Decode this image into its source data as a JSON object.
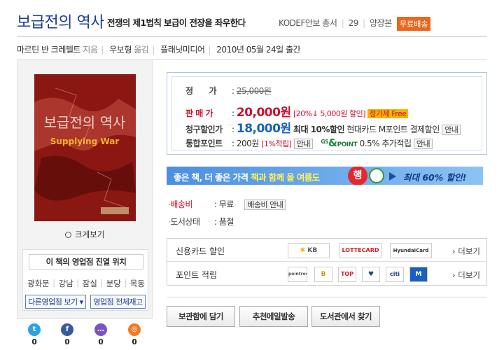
{
  "header": {
    "title": "보급전의 역사",
    "subtitle": "전쟁의 제1법칙 보급이 전장을 좌우한다",
    "series": "KODEF안보 총서",
    "series_no": "29",
    "publisher_label": "양장본",
    "free_shipping_badge": "무료배송"
  },
  "meta": {
    "author": "마르틴 반 크레펠트",
    "author_role": "지음",
    "translator": "우보형",
    "translator_role": "옮김",
    "publisher": "플래닛미디어",
    "pub_date": "2010년 05월 24일",
    "pub_suffix": "출간"
  },
  "cover": {
    "title": "보급전의 역사",
    "subtitle": "Supplying War"
  },
  "left": {
    "zoom_label": "크게보기",
    "store_header": "이 책의 영업점 진열 위치",
    "stores": [
      "광화문",
      "강남",
      "잠실",
      "분당",
      "목동"
    ],
    "btn_other_stores": "다른영업점 보기",
    "btn_all_stock": "영업점 전체재고",
    "social_counts": [
      "0",
      "0",
      "0",
      "0"
    ]
  },
  "price": {
    "list_label": "정　　가",
    "list_price": "25,000원",
    "sale_label": "판 매 가",
    "sale_price": "20,000원",
    "discount": "[20%↓ 5,000원 할인]",
    "fixed_price_badge": "정가제 Free",
    "billing_label": "청구할인가",
    "billing_price": "18,000원",
    "billing_note": "최대 10%할인",
    "billing_card": "현대카드 M포인트 결제할인",
    "guide_btn": "안내",
    "points_label": "통합포인트",
    "points_value": "200원",
    "points_rate": "[1%적립]",
    "gs_point_rate": "0.5% 추가적립",
    "gs_logo_text": "GS",
    "gs_point_word": "POINT"
  },
  "banner": {
    "text_pre": "좋은 책, 더 좋은 가격",
    "text_mid": "책과 함께 올 여름도",
    "badge": "행",
    "text_right": "최대 60% 할인!"
  },
  "delivery": {
    "shipping_label": "배송비",
    "shipping_value": "무료",
    "shipping_btn": "배송비 안내",
    "status_label": "도서상태",
    "status_value": "품절"
  },
  "payments": {
    "card_label": "신용카드 할인",
    "card_logos": [
      "KB",
      "LOTTECARD",
      "HyundaiCard"
    ],
    "point_label": "포인트 적립",
    "point_logos": [
      "pointree",
      "B",
      "TOP",
      "♥",
      "citi",
      "M"
    ],
    "more": "› 더보기"
  },
  "actions": {
    "wishlist": "보관함에 담기",
    "recommend_mail": "추천메일발송",
    "library": "도서관에서 찾기"
  },
  "colors": {
    "title_blue": "#1a3f91",
    "price_red": "#c8102e",
    "badge_orange": "#e8681e"
  }
}
